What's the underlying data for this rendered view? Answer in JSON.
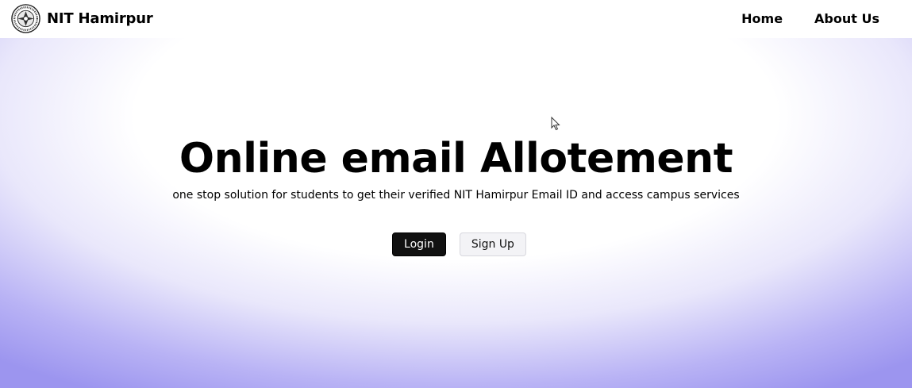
{
  "navbar": {
    "brand_name": "NIT Hamirpur",
    "logo_icon": "institute-seal-icon",
    "links": [
      "Home",
      "About Us"
    ]
  },
  "hero": {
    "title": "Online email Allotement",
    "subtitle": "one stop solution for students to get their verified NIT Hamirpur Email ID and access campus services",
    "login_label": "Login",
    "signup_label": "Sign Up"
  },
  "colors": {
    "login_bg": "#111111",
    "signup_bg": "#f3f3f6",
    "gradient_edge": "#9c95ef",
    "gradient_center": "#ffffff"
  }
}
